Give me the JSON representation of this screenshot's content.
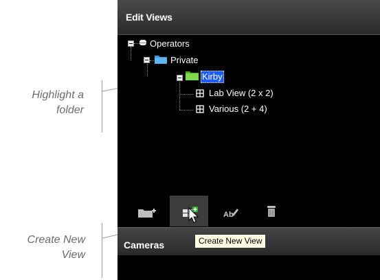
{
  "annotations": {
    "highlight_folder": "Highlight a\nfolder",
    "create_new_view": "Create New\nView"
  },
  "panel": {
    "title": "Edit Views",
    "tree": {
      "root": "Operators",
      "private": "Private",
      "folder": "Kirby",
      "views": [
        "Lab View (2 x 2)",
        "Various (2 + 4)"
      ]
    },
    "toolbar": {
      "buttons": [
        "new-folder",
        "create-new-view",
        "rename",
        "delete"
      ],
      "active": "create-new-view"
    },
    "cameras_title": "Cameras",
    "tooltip": "Create New View"
  },
  "colors": {
    "panel_bg": "#000000",
    "selection": "#1c5cff",
    "folder_blue": "#2f9be6",
    "folder_green": "#6cc83a",
    "annotation_text": "#6b6b6b"
  }
}
